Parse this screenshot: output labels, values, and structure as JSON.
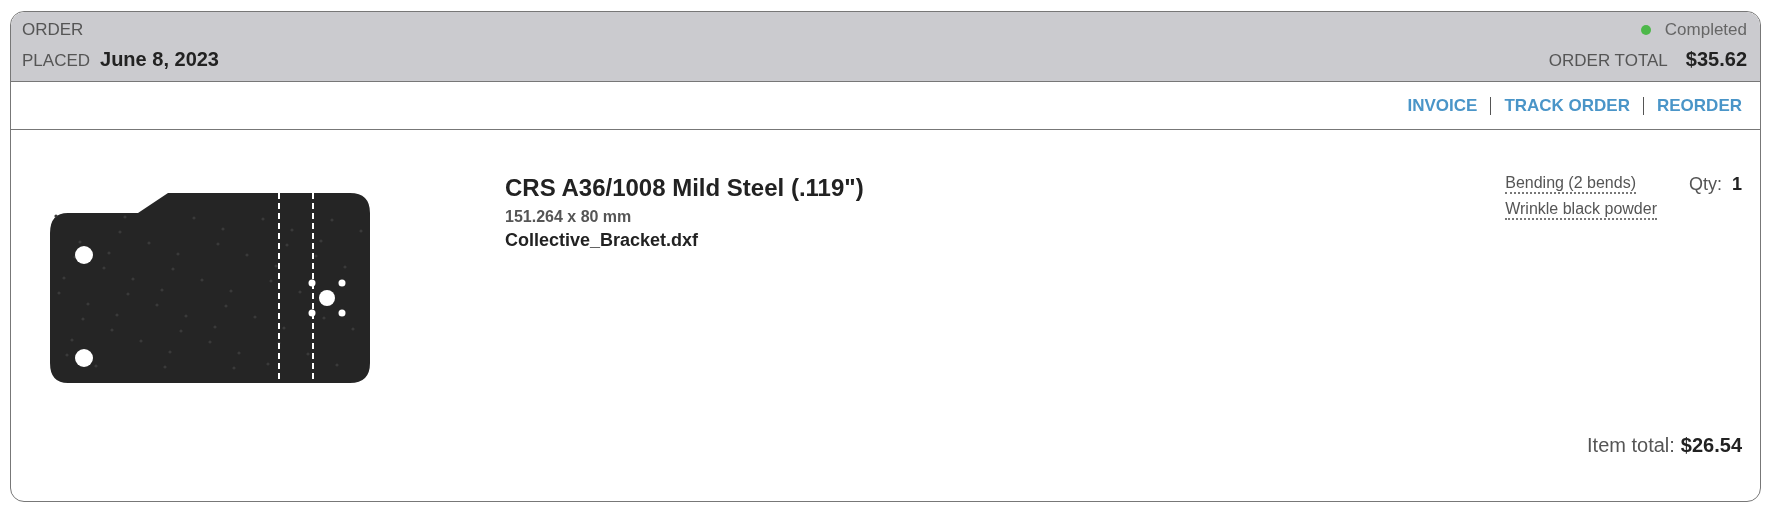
{
  "order": {
    "label": "ORDER",
    "placed_label": "PLACED",
    "placed_date": "June 8, 2023",
    "status": "Completed",
    "total_label": "ORDER TOTAL",
    "total": "$35.62"
  },
  "actions": [
    "INVOICE",
    "TRACK ORDER",
    "REORDER"
  ],
  "item": {
    "material": "CRS A36/1008 Mild Steel (.119\")",
    "dimensions": "151.264 x 80 mm",
    "file": "Collective_Bracket.dxf",
    "options": [
      "Bending (2 bends)",
      "Wrinkle black powder"
    ],
    "qty_label": "Qty:",
    "qty": "1",
    "total_label": "Item total:",
    "total": "$26.54"
  }
}
